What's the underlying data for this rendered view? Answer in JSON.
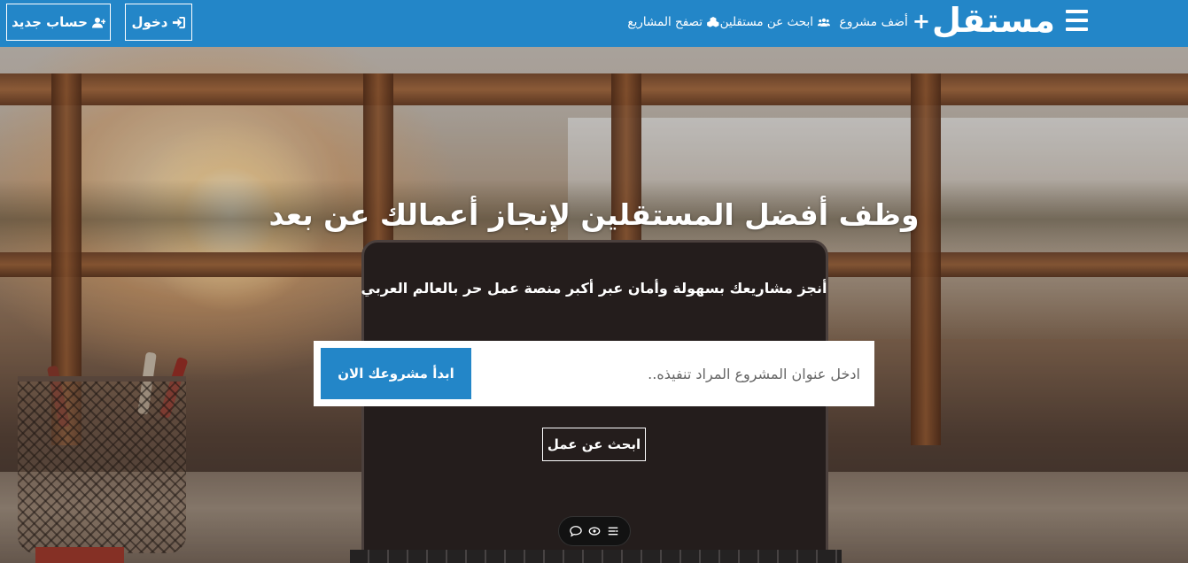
{
  "header": {
    "logo": "مستقل",
    "nav": {
      "add_project": "أضف مشروع",
      "find_freelancers": "ابحث عن مستقلين",
      "browse_projects": "تصفح المشاريع"
    },
    "auth": {
      "login": "دخول",
      "register": "حساب جديد"
    },
    "brand_color": "#2386c8"
  },
  "hero": {
    "title": "وظف أفضل المستقلين لإنجاز أعمالك عن بعد",
    "subtitle": "أنجز مشاريعك بسهولة وأمان عبر أكبر منصة عمل حر بالعالم العربي",
    "search": {
      "placeholder": "ادخل عنوان المشروع المراد تنفيذه..",
      "button": "ابدأ مشروعك الان"
    },
    "find_work": "ابحث عن عمل"
  },
  "floating_toolbar": {
    "icons": [
      "chat-icon",
      "eye-icon",
      "list-icon"
    ]
  }
}
